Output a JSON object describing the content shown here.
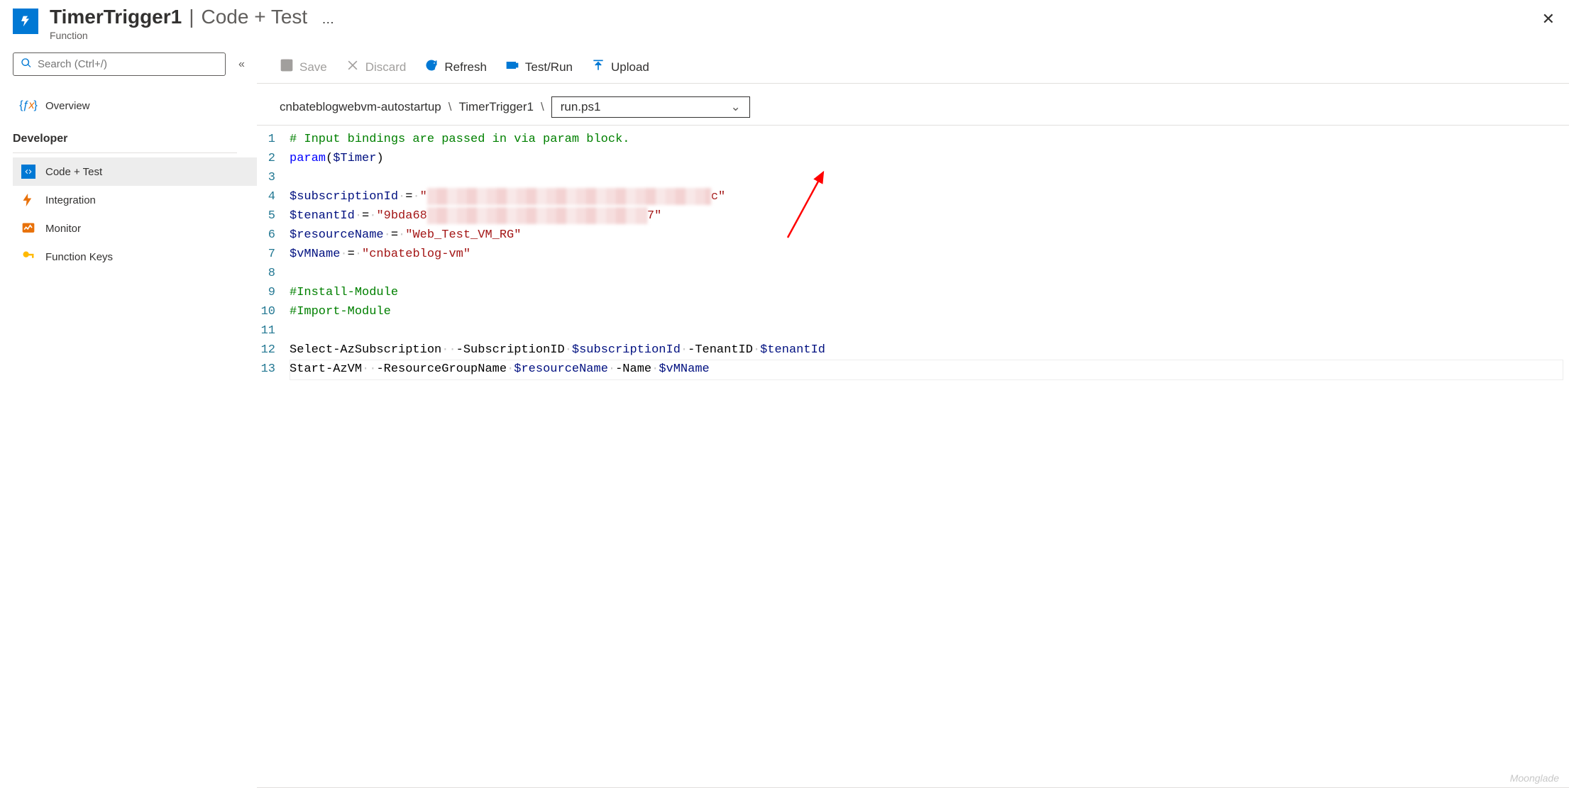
{
  "header": {
    "title": "TimerTrigger1",
    "section": "Code + Test",
    "subtitle": "Function",
    "more": "…"
  },
  "sidebar": {
    "search_placeholder": "Search (Ctrl+/)",
    "overview_label": "Overview",
    "dev_section": "Developer",
    "items": {
      "codetest": "Code + Test",
      "integration": "Integration",
      "monitor": "Monitor",
      "fnkeys": "Function Keys"
    }
  },
  "toolbar": {
    "save": "Save",
    "discard": "Discard",
    "refresh": "Refresh",
    "testrun": "Test/Run",
    "upload": "Upload"
  },
  "breadcrumb": {
    "app": "cnbateblogwebvm-autostartup",
    "func": "TimerTrigger1",
    "file": "run.ps1"
  },
  "code": {
    "line1_comment": "# Input bindings are passed in via param block.",
    "line2_param": "param",
    "line2_timer": "$Timer",
    "line4_var": "$subscriptionId",
    "line4_val_suffix": "c",
    "line5_var": "$tenantId",
    "line5_val_prefix": "9bda68",
    "line5_val_suffix": "7",
    "line6_var": "$resourceName",
    "line6_val": "Web_Test_VM_RG",
    "line7_var": "$vMName",
    "line7_val": "cnbateblog-vm",
    "line9": "#Install-Module",
    "line10": "#Import-Module",
    "line12_cmd": "Select-AzSubscription",
    "line12_p1": "-SubscriptionID",
    "line12_v1": "$subscriptionId",
    "line12_p2": "-TenantID",
    "line12_v2": "$tenantId",
    "line13_cmd": "Start-AzVM",
    "line13_p1": "-ResourceGroupName",
    "line13_v1": "$resourceName",
    "line13_p2": "-Name",
    "line13_v2": "$vMName"
  },
  "watermark": "Moonglade"
}
